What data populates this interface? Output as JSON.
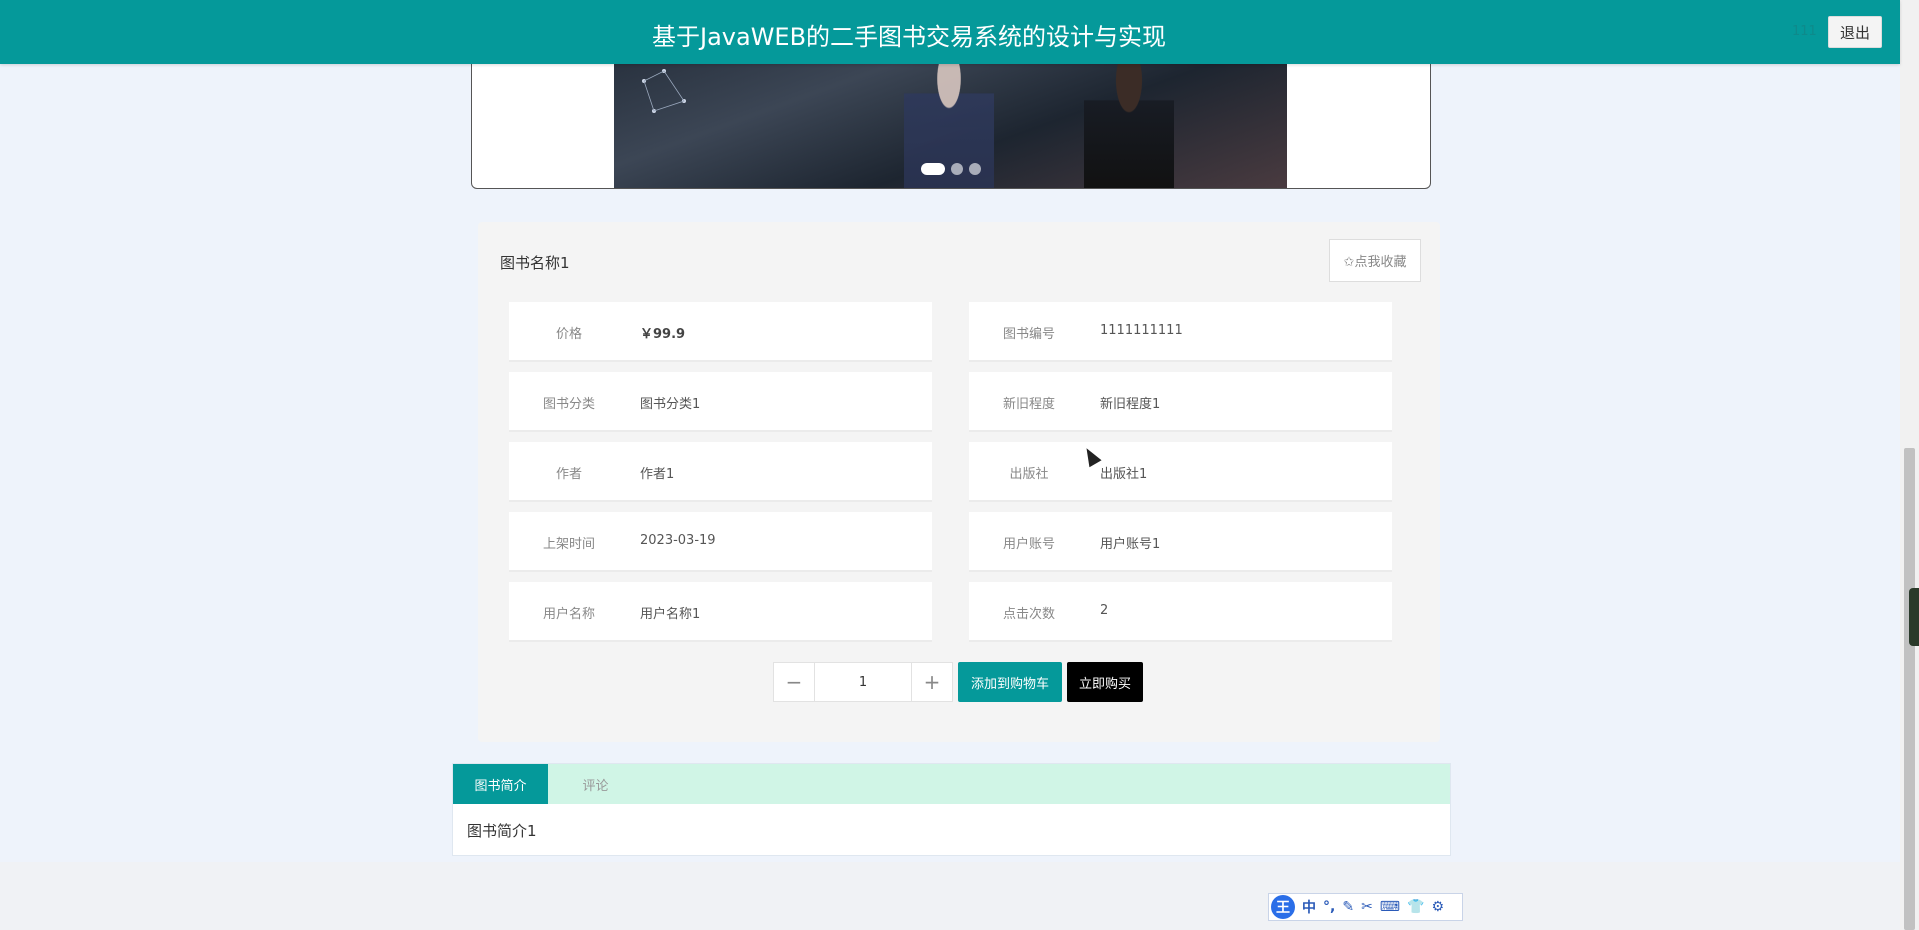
{
  "header": {
    "title": "基于JavaWEB的二手图书交易系统的设计与实现",
    "username": "111",
    "logout_label": "退出"
  },
  "banner": {
    "slide_count": 3,
    "active_slide": 1
  },
  "book": {
    "name": "图书名称1",
    "favorite_label": "✩点我收藏",
    "fields": [
      {
        "label": "价格",
        "value": "￥99.9"
      },
      {
        "label": "图书编号",
        "value": "1111111111"
      },
      {
        "label": "图书分类",
        "value": "图书分类1"
      },
      {
        "label": "新旧程度",
        "value": "新旧程度1"
      },
      {
        "label": "作者",
        "value": "作者1"
      },
      {
        "label": "出版社",
        "value": "出版社1"
      },
      {
        "label": "上架时间",
        "value": "2023-03-19"
      },
      {
        "label": "用户账号",
        "value": "用户账号1"
      },
      {
        "label": "用户名称",
        "value": "用户名称1"
      },
      {
        "label": "点击次数",
        "value": "2"
      }
    ],
    "quantity": "1",
    "minus_label": "−",
    "plus_label": "+",
    "add_cart_label": "添加到购物车",
    "buy_now_label": "立即购买"
  },
  "tabs": {
    "items": [
      {
        "label": "图书简介"
      },
      {
        "label": "评论"
      }
    ],
    "content": "图书简介1"
  },
  "ime": {
    "logo": "王",
    "items": [
      "中",
      "°,",
      "✎",
      "✂",
      "⌨",
      "👕",
      "⚙"
    ]
  },
  "colors": {
    "primary": "#05999a",
    "tabbar": "#d0f5e6",
    "page_bg": "#eef3fb"
  }
}
